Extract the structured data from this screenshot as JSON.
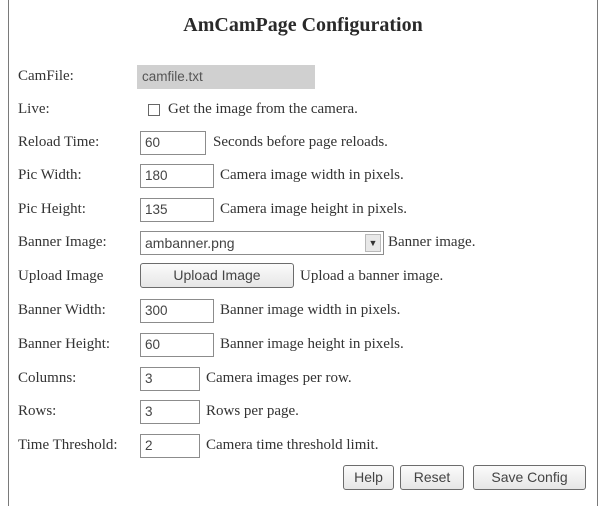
{
  "title": "AmCamPage Configuration",
  "fields": {
    "camfile": {
      "label": "CamFile:",
      "value": "camfile.txt"
    },
    "live": {
      "label": "Live:",
      "checkbox_label": "Get the image from the camera.",
      "checked": false
    },
    "reload_time": {
      "label": "Reload Time:",
      "value": "60",
      "desc": "Seconds before page reloads."
    },
    "pic_width": {
      "label": "Pic Width:",
      "value": "180",
      "desc": "Camera image width in pixels."
    },
    "pic_height": {
      "label": "Pic Height:",
      "value": "135",
      "desc": "Camera image height in pixels."
    },
    "banner_image": {
      "label": "Banner Image:",
      "value": "ambanner.png",
      "desc": "Banner image."
    },
    "upload_image": {
      "label": "Upload Image",
      "button": "Upload Image",
      "desc": "Upload a banner image."
    },
    "banner_width": {
      "label": "Banner Width:",
      "value": "300",
      "desc": "Banner image width in pixels."
    },
    "banner_height": {
      "label": "Banner Height:",
      "value": "60",
      "desc": "Banner image height in pixels."
    },
    "columns": {
      "label": "Columns:",
      "value": "3",
      "desc": "Camera images per row."
    },
    "rows": {
      "label": "Rows:",
      "value": "3",
      "desc": "Rows per page."
    },
    "time_threshold": {
      "label": "Time Threshold:",
      "value": "2",
      "desc": "Camera time threshold limit."
    }
  },
  "buttons": {
    "help": "Help",
    "reset": "Reset",
    "save": "Save Config"
  }
}
